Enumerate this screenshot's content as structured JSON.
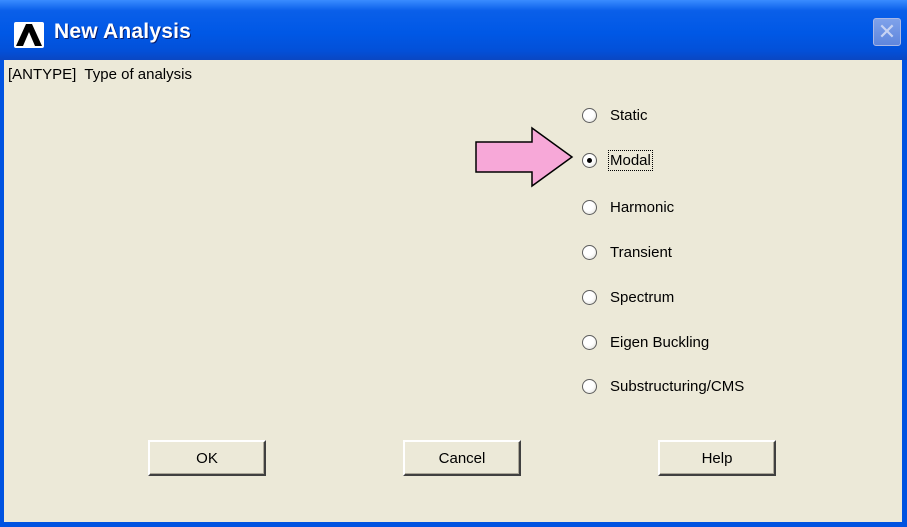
{
  "window": {
    "title": "New Analysis",
    "close_label": "✕"
  },
  "dialog": {
    "header": "[ANTYPE]  Type of analysis",
    "options": [
      {
        "label": "Static",
        "selected": false
      },
      {
        "label": "Modal",
        "selected": true
      },
      {
        "label": "Harmonic",
        "selected": false
      },
      {
        "label": "Transient",
        "selected": false
      },
      {
        "label": "Spectrum",
        "selected": false
      },
      {
        "label": "Eigen Buckling",
        "selected": false
      },
      {
        "label": "Substructuring/CMS",
        "selected": false
      }
    ],
    "buttons": {
      "ok": "OK",
      "cancel": "Cancel",
      "help": "Help"
    },
    "annotation": {
      "arrow_color": "#f7a8d8"
    }
  }
}
